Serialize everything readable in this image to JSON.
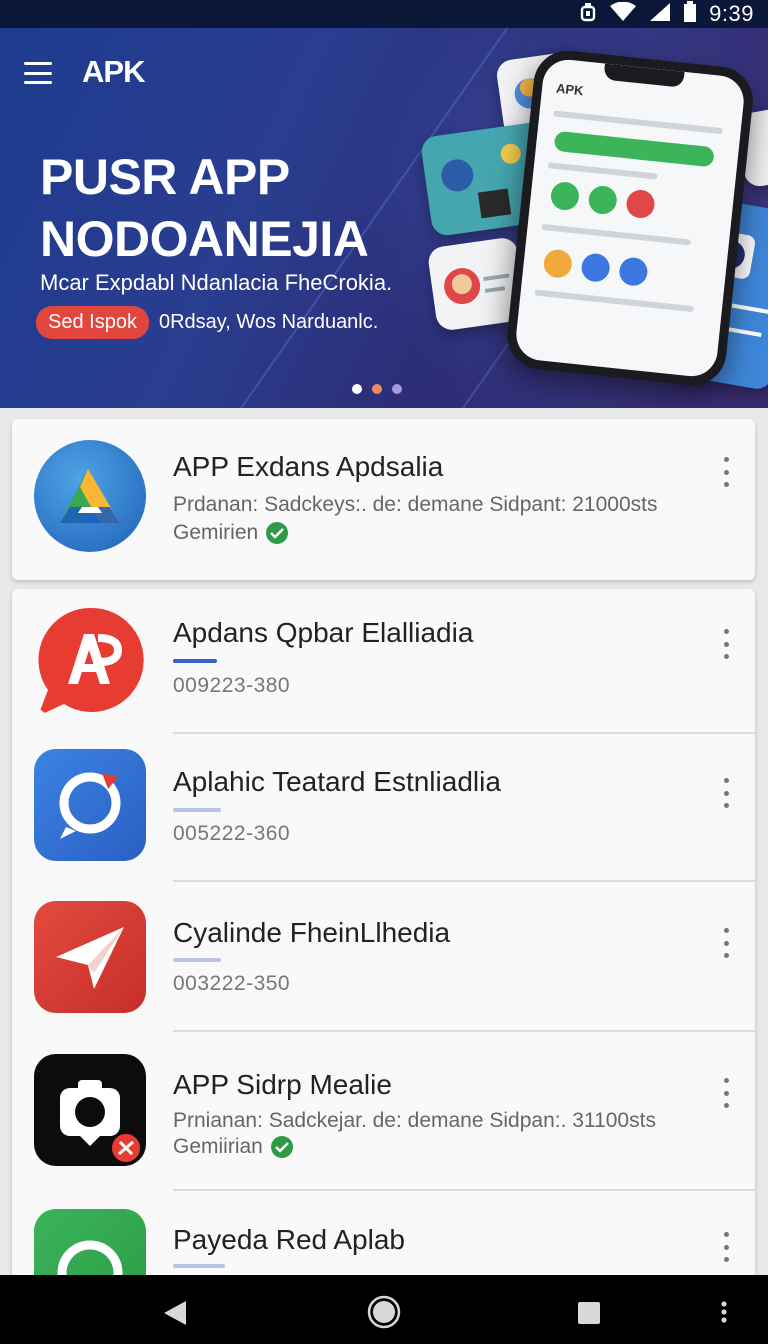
{
  "status_bar": {
    "time": "9:39",
    "icons": [
      "alarm-icon",
      "wifi-icon",
      "signal-icon",
      "battery-icon"
    ]
  },
  "hero": {
    "brand": "APK",
    "title_line1": "PUSR APP",
    "title_line2": "NODOANEJIA",
    "subtitle": "Mcar Expdabl Ndanlacia FheCrokia.",
    "cta_label": "Sed Ispok",
    "note": "0Rdsay, Wos Narduanlc.",
    "phone_title": "APK",
    "carousel_dots": 3,
    "active_dot": 0,
    "colors": {
      "cta": "#e2453c",
      "dot_active": "#ffffff",
      "dot_2": "#f08a5d",
      "dot_3": "#a99ae0"
    }
  },
  "featured": {
    "name": "APP Exdans Apdsalia",
    "description": "Prdanan: Sadckeys:. de: demane Sidpant: 21000sts",
    "meta": "Gemirien",
    "icon": "triangle-logo-icon"
  },
  "apps": [
    {
      "name": "Apdans Qpbar Elalliadia",
      "code": "009223-380",
      "icon": "ap-bubble-icon",
      "progress": 0.4,
      "progress_color": "#3a5fc7"
    },
    {
      "name": "Aplahic Teatard Estnliadlia",
      "code": "005222-360",
      "icon": "chat-ring-icon",
      "progress": 0.4,
      "progress_color": "#b8c4e6"
    },
    {
      "name": "Cyalinde FheinLlhedia",
      "code": "003222-350",
      "icon": "paper-plane-icon",
      "progress": 0.4,
      "progress_color": "#b8c4e6"
    },
    {
      "name": "APP Sidrp Mealie",
      "description": "Prnianan: Sadckejar. de: demane Sidpan:. 31100sts",
      "meta": "Gemiirian",
      "icon": "camera-icon"
    },
    {
      "name": "Payeda Red Aplab",
      "icon": "green-ring-icon",
      "progress": 0.4,
      "progress_color": "#b8c4e6"
    }
  ],
  "nav": {
    "buttons": [
      "back-icon",
      "home-icon",
      "recents-icon",
      "overflow-icon"
    ]
  }
}
